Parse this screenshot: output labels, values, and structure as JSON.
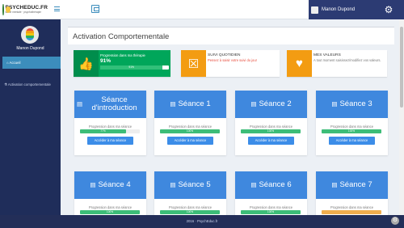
{
  "header": {
    "logo_title": "PSYCHEDUC.FR",
    "logo_sub": "santé mentale · psychothérapie",
    "user_name": "Manon Dupond"
  },
  "sidebar": {
    "user_name": "Manon Dupond",
    "items": [
      {
        "label": "Accueil",
        "active": true
      },
      {
        "label": "Activation comportementale",
        "active": false
      }
    ]
  },
  "main": {
    "page_title": "Activation Comportementale",
    "therapy_box": {
      "title": "Progression dans ma thérapie",
      "percent": "91%",
      "bar_label": "91%",
      "progress": 0.91
    },
    "daily_box": {
      "title": "SUIVI QUOTIDIEN",
      "desc": "Pensez à saisir votre suivi du jour"
    },
    "values_box": {
      "title": "MES VALEURS",
      "desc": "A tout moment saisissez/modifiez vos valeurs."
    },
    "session_progress_label": "Progression dans ma séance",
    "session_button_label": "Accéder à ma séance",
    "sessions": [
      {
        "title": "Séance d'introduction",
        "bar_label": "77%",
        "progress": 0.77,
        "color": "#3dbd78"
      },
      {
        "title": "Séance 1",
        "bar_label": "100%",
        "progress": 1.0,
        "color": "#3dbd78"
      },
      {
        "title": "Séance 2",
        "bar_label": "100%",
        "progress": 1.0,
        "color": "#3dbd78"
      },
      {
        "title": "Séance 3",
        "bar_label": "100%",
        "progress": 1.0,
        "color": "#3dbd78"
      },
      {
        "title": "Séance 4",
        "bar_label": "100%",
        "progress": 1.0,
        "color": "#3dbd78"
      },
      {
        "title": "Séance 5",
        "bar_label": "100%",
        "progress": 1.0,
        "color": "#3dbd78"
      },
      {
        "title": "Séance 6",
        "bar_label": "100%",
        "progress": 1.0,
        "color": "#3dbd78"
      },
      {
        "title": "Séance 7",
        "bar_label": "",
        "progress": 1.0,
        "color": "#f0ad4e"
      }
    ]
  },
  "footer": {
    "text": "2016 · PsychEduc.fr"
  },
  "colors": {
    "primary": "#3c8dbc",
    "card_head": "#3f88de",
    "success": "#00a65a",
    "warning": "#f39c12",
    "sidebar": "#1f2d5a"
  }
}
